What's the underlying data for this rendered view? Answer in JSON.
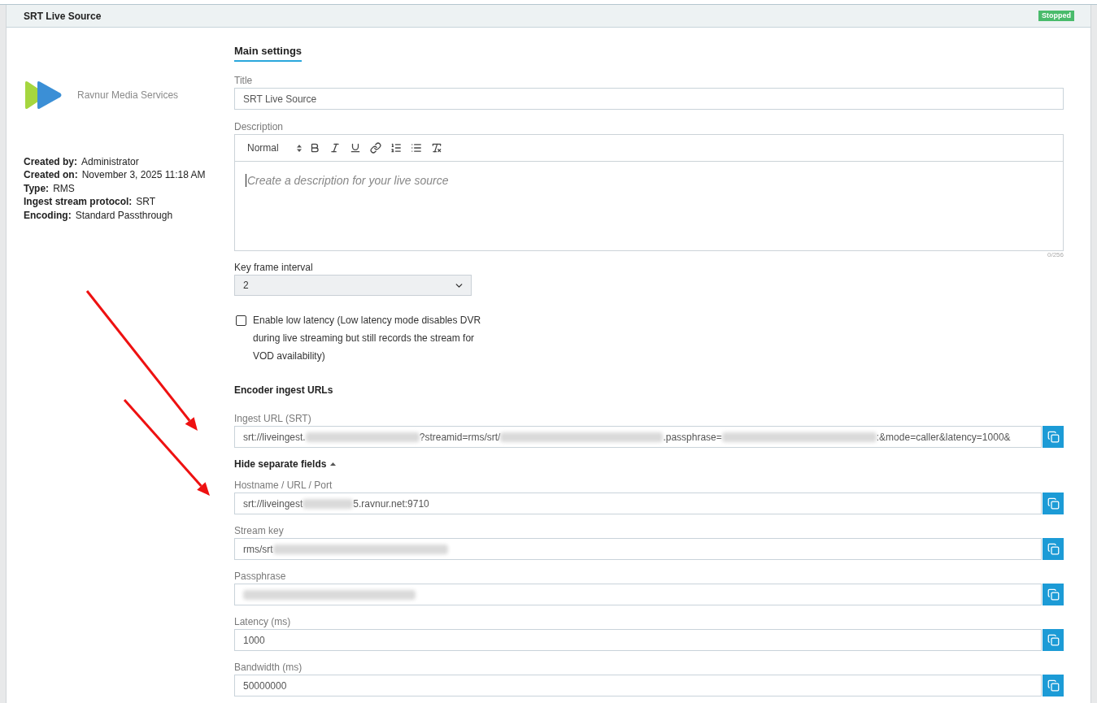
{
  "header": {
    "title": "SRT Live Source",
    "status": "Stopped"
  },
  "sidebar": {
    "company": "Ravnur Media Services",
    "details": [
      {
        "label": "Created by:",
        "value": "Administrator"
      },
      {
        "label": "Created on:",
        "value": "November 3, 2025 11:18 AM"
      },
      {
        "label": "Type:",
        "value": "RMS"
      },
      {
        "label": "Ingest stream protocol:",
        "value": "SRT"
      },
      {
        "label": "Encoding:",
        "value": "Standard Passthrough"
      }
    ]
  },
  "tabs": [
    {
      "label": "Main settings",
      "selected": true
    }
  ],
  "form": {
    "title": {
      "label": "Title",
      "value": "SRT Live Source"
    },
    "description": {
      "label": "Description",
      "format": "Normal",
      "placeholder": "Create a description for your live source",
      "counter": "0/256"
    },
    "key_frame_interval": {
      "label": "Key frame interval",
      "value": "2"
    },
    "low_latency": {
      "label": "Enable low latency (Low latency mode disables DVR during live streaming but still records the stream for VOD availability)",
      "checked": false
    }
  },
  "encoder": {
    "heading": "Encoder ingest URLs",
    "ingest_url": {
      "label": "Ingest URL (SRT)",
      "value": [
        {
          "kind": "text",
          "text": "srt://liveingest."
        },
        {
          "kind": "redacted"
        },
        {
          "kind": "text",
          "text": "?streamid=rms/srt/"
        },
        {
          "kind": "redacted"
        },
        {
          "kind": "text",
          "text": ".passphrase="
        },
        {
          "kind": "redacted"
        },
        {
          "kind": "text",
          "text": ":&mode=caller&latency=1000&"
        }
      ]
    },
    "toggle": {
      "label": "Hide separate fields",
      "expanded": true
    },
    "fields": [
      {
        "label": "Hostname / URL / Port",
        "value": [
          {
            "kind": "text",
            "text": "srt://liveingest"
          },
          {
            "kind": "redacted"
          },
          {
            "kind": "text",
            "text": "5.ravnur.net:9710"
          }
        ]
      },
      {
        "label": "Stream key",
        "value": [
          {
            "kind": "text",
            "text": "rms/srt"
          },
          {
            "kind": "redacted"
          }
        ]
      },
      {
        "label": "Passphrase",
        "value": [
          {
            "kind": "redacted"
          }
        ]
      },
      {
        "label": "Latency (ms)",
        "value": [
          {
            "kind": "text",
            "text": "1000"
          }
        ]
      },
      {
        "label": "Bandwidth (ms)",
        "value": [
          {
            "kind": "text",
            "text": "50000000"
          }
        ]
      }
    ]
  },
  "annotations": [
    {
      "kind": "arrow"
    },
    {
      "kind": "arrow"
    }
  ]
}
